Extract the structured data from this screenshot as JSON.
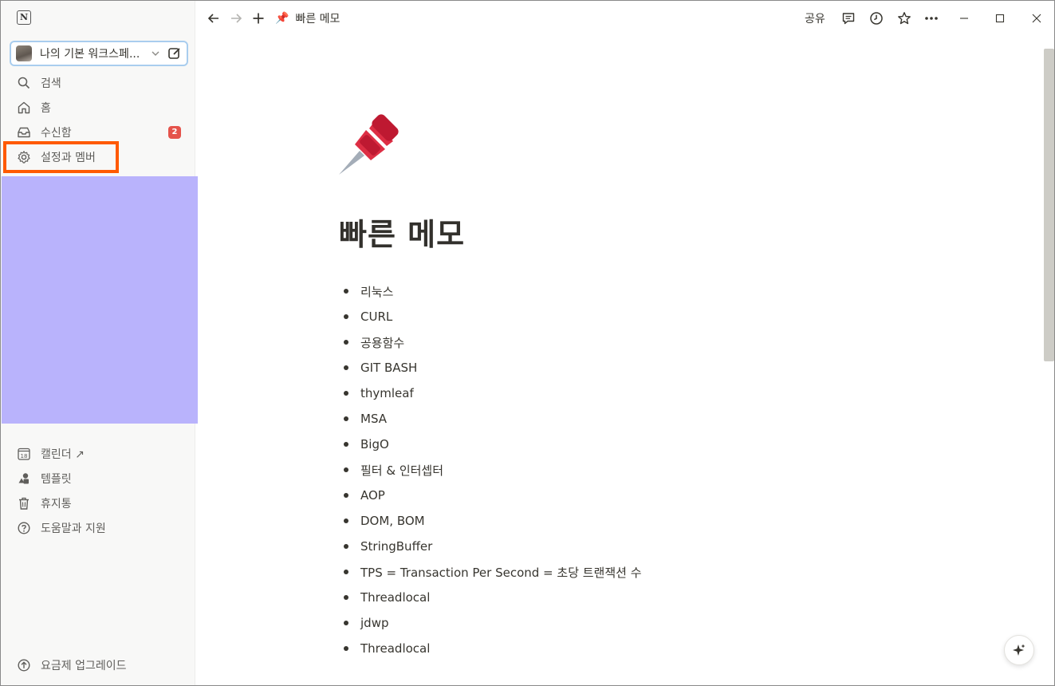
{
  "workspace": {
    "name": "나의 기본 워크스페..."
  },
  "sidebar": {
    "top_items": [
      {
        "label": "검색",
        "icon": "search-icon"
      },
      {
        "label": "홈",
        "icon": "home-icon"
      },
      {
        "label": "수신함",
        "icon": "inbox-icon",
        "badge": "2"
      },
      {
        "label": "설정과 멤버",
        "icon": "gear-icon"
      }
    ],
    "bottom_items": [
      {
        "label": "캘린더 ↗",
        "icon": "calendar-icon",
        "icon_text": "18"
      },
      {
        "label": "템플릿",
        "icon": "templates-icon"
      },
      {
        "label": "휴지통",
        "icon": "trash-icon"
      },
      {
        "label": "도움말과 지원",
        "icon": "help-icon"
      }
    ],
    "upgrade_label": "요금제 업그레이드"
  },
  "topbar": {
    "breadcrumb_icon": "📌",
    "breadcrumb_title": "빠른 메모",
    "share_label": "공유"
  },
  "page": {
    "icon": "pushpin-icon",
    "title": "빠른 메모",
    "bullets": [
      "리눅스",
      "CURL",
      "공용함수",
      "GIT BASH",
      "thymleaf",
      "MSA",
      "BigO",
      "필터 & 인터셉터",
      "AOP",
      "DOM, BOM",
      "StringBuffer",
      "TPS = Transaction Per Second = 초당 트랜잭션 수",
      "Threadlocal",
      "jdwp",
      "Threadlocal"
    ]
  },
  "colors": {
    "highlight": "#ff5a00",
    "overlay": "#b9b3fc",
    "badge": "#e5534b",
    "workspace_border": "#a9cdee"
  }
}
